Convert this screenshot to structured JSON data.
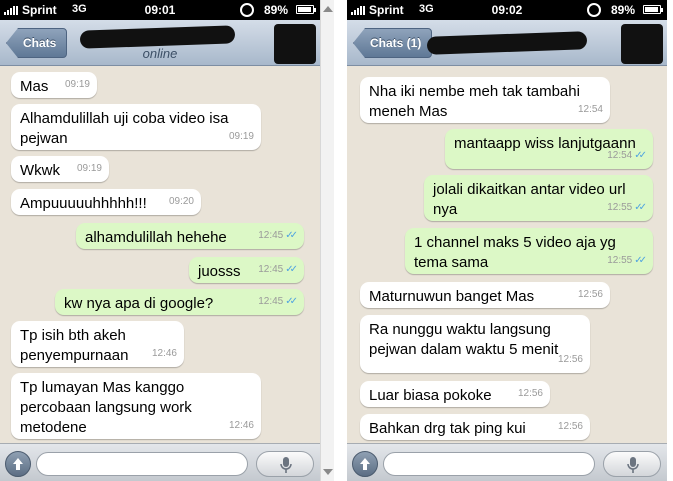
{
  "colors": {
    "outgoing_bubble": "#dcf8c6",
    "incoming_bubble": "#ffffff",
    "read_ticks": "#4fa3e0",
    "nav_bar": "#a8b8cb"
  },
  "left": {
    "status": {
      "carrier": "Sprint",
      "network": "3G",
      "time": "09:01",
      "battery": "89%"
    },
    "nav": {
      "back_label": "Chats",
      "contact_status": "online"
    },
    "messages": [
      {
        "dir": "in",
        "text": "Mas",
        "time": "09:19"
      },
      {
        "dir": "in",
        "text": "Alhamdulillah uji coba video isa pejwan",
        "time": "09:19"
      },
      {
        "dir": "in",
        "text": "Wkwk",
        "time": "09:19"
      },
      {
        "dir": "in",
        "text": "Ampuuuuuhhhhh!!!",
        "time": "09:20"
      },
      {
        "dir": "out",
        "text": "alhamdulillah hehehe",
        "time": "12:45"
      },
      {
        "dir": "out",
        "text": "juosss",
        "time": "12:45"
      },
      {
        "dir": "out",
        "text": "kw nya apa di google?",
        "time": "12:45"
      },
      {
        "dir": "in",
        "text": "Tp isih bth akeh penyempurnaan",
        "time": "12:46"
      },
      {
        "dir": "in",
        "text": "Tp lumayan Mas kanggo percobaan langsung work metodene",
        "time": "12:46"
      }
    ]
  },
  "right": {
    "status": {
      "carrier": "Sprint",
      "network": "3G",
      "time": "09:02",
      "battery": "89%"
    },
    "nav": {
      "back_label": "Chats (1)"
    },
    "messages": [
      {
        "dir": "in",
        "text": "Nha iki nembe meh tak tambahi meneh Mas",
        "time": "12:54"
      },
      {
        "dir": "out",
        "text": "mantaapp wiss lanjutgaann",
        "time": "12:54"
      },
      {
        "dir": "out",
        "text": "jolali dikaitkan antar video url nya",
        "time": "12:55"
      },
      {
        "dir": "out",
        "text": "1 channel maks 5 video aja yg tema sama",
        "time": "12:55"
      },
      {
        "dir": "in",
        "text": "Maturnuwun banget Mas",
        "time": "12:56"
      },
      {
        "dir": "in",
        "text": "Ra nunggu waktu langsung pejwan dalam waktu 5 menit",
        "time": "12:56"
      },
      {
        "dir": "in",
        "text": "Luar biasa pokoke",
        "time": "12:56"
      },
      {
        "dir": "in",
        "text": "Bahkan drg tak ping kui",
        "time": "12:56"
      }
    ]
  },
  "icons": {
    "attach": "upload-arrow-icon",
    "mic": "microphone-icon",
    "ticks": "double-check-icon",
    "lock": "rotation-lock-icon"
  }
}
